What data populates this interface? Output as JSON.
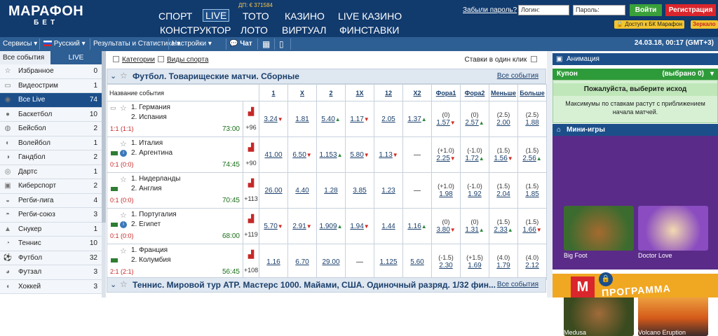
{
  "brand": {
    "line1": "МАРАФОН",
    "line2": "БЕТ",
    "dp": "ДП: € 371584"
  },
  "nav": {
    "row1": [
      "СПОРТ",
      "LIVE",
      "ТОТО",
      "КАЗИНО",
      "LIVE КАЗИНО"
    ],
    "row2": [
      "КОНСТРУКТОР",
      "ЛОТО",
      "ВИРТУАЛ",
      "ФИНСТАВКИ"
    ]
  },
  "auth": {
    "forgot": "Забыли пароль?",
    "login_placeholder": "Логин:",
    "password_placeholder": "Пароль:",
    "login_btn": "Войти",
    "register_btn": "Регистрация",
    "access": "Доступ к БК Марафон",
    "mirror": "Зеркало"
  },
  "toolbar": {
    "services": "Сервисы",
    "language": "Русский",
    "results": "Результаты и Статистика",
    "settings": "Настройки",
    "chat": "Чат",
    "date": "24.03.18, 00:17 (GMT+3)"
  },
  "sidebar": {
    "tabs": [
      "Все события",
      "LIVE"
    ],
    "items": [
      {
        "label": "Избранное",
        "count": "0",
        "icon": "☆"
      },
      {
        "label": "Видеострим",
        "count": "1",
        "icon": "▭"
      },
      {
        "label": "Все Live",
        "count": "74",
        "icon": "◉"
      },
      {
        "label": "Баскетбол",
        "count": "10",
        "icon": "●"
      },
      {
        "label": "Бейсбол",
        "count": "2",
        "icon": "◍"
      },
      {
        "label": "Волейбол",
        "count": "1",
        "icon": "◐"
      },
      {
        "label": "Гандбол",
        "count": "2",
        "icon": "◑"
      },
      {
        "label": "Дартс",
        "count": "1",
        "icon": "◎"
      },
      {
        "label": "Киберспорт",
        "count": "2",
        "icon": "▣"
      },
      {
        "label": "Регби-лига",
        "count": "4",
        "icon": "◒"
      },
      {
        "label": "Регби-союз",
        "count": "3",
        "icon": "◓"
      },
      {
        "label": "Снукер",
        "count": "1",
        "icon": "▲"
      },
      {
        "label": "Теннис",
        "count": "10",
        "icon": "◔"
      },
      {
        "label": "Футбол",
        "count": "32",
        "icon": "⚽"
      },
      {
        "label": "Футзал",
        "count": "3",
        "icon": "◕"
      },
      {
        "label": "Хоккей",
        "count": "3",
        "icon": "◖"
      }
    ]
  },
  "filters": {
    "categories": "Категории",
    "sports_types": "Виды спорта",
    "one_click": "Ставки в один клик"
  },
  "group1": {
    "title": "Футбол. Товарищеские матчи. Сборные",
    "all_events": "Все события"
  },
  "columns": {
    "name": "Название события",
    "c1": "1",
    "cx": "X",
    "c2": "2",
    "c1x": "1X",
    "c12": "12",
    "cx2": "X2",
    "f1": "Фора1",
    "f2": "Фора2",
    "less": "Меньше",
    "more": "Больше"
  },
  "events": [
    {
      "t1": "1. Германия",
      "t2": "2. Испания",
      "score": "1:1 (1:1)",
      "time": "73:00",
      "plus": "+96",
      "o": [
        "3.24",
        "1.81",
        "5.40",
        "1.17",
        "2.05",
        "1.37"
      ],
      "dir": [
        "dn",
        "",
        "up",
        "dn",
        "",
        "up"
      ],
      "h1": "(0)",
      "h1v": "1.57",
      "h1d": "dn",
      "h2": "(0)",
      "h2v": "2.57",
      "h2d": "up",
      "lh": "(2.5)",
      "lv": "2.00",
      "ld": "",
      "mh": "(2.5)",
      "mv": "1.88",
      "md": ""
    },
    {
      "t1": "1. Италия",
      "t2": "2. Аргентина",
      "score": "0:1 (0:0)",
      "time": "74:45",
      "plus": "+90",
      "o": [
        "41.00",
        "6.50",
        "1.153",
        "5.80",
        "1.13",
        "—"
      ],
      "dir": [
        "",
        "dn",
        "up",
        "dn",
        "dn",
        ""
      ],
      "h1": "(+1.0)",
      "h1v": "2.25",
      "h1d": "dn",
      "h2": "(-1.0)",
      "h2v": "1.72",
      "h2d": "up",
      "lh": "(1.5)",
      "lv": "1.56",
      "ld": "dn",
      "mh": "(1.5)",
      "mv": "2.56",
      "md": "up"
    },
    {
      "t1": "1. Нидерланды",
      "t2": "2. Англия",
      "score": "0:1 (0:0)",
      "time": "70:45",
      "plus": "+113",
      "o": [
        "26.00",
        "4.40",
        "1.28",
        "3.85",
        "1.23",
        "—"
      ],
      "dir": [
        "",
        "",
        "",
        "",
        "",
        ""
      ],
      "h1": "(+1.0)",
      "h1v": "1.98",
      "h1d": "",
      "h2": "(-1.0)",
      "h2v": "1.92",
      "h2d": "",
      "lh": "(1.5)",
      "lv": "2.04",
      "ld": "",
      "mh": "(1.5)",
      "mv": "1.85",
      "md": ""
    },
    {
      "t1": "1. Португалия",
      "t2": "2. Египет",
      "score": "0:1 (0:0)",
      "time": "68:00",
      "plus": "+119",
      "o": [
        "5.70",
        "2.91",
        "1.909",
        "1.94",
        "1.44",
        "1.16"
      ],
      "dir": [
        "dn",
        "dn",
        "up",
        "dn",
        "",
        "up"
      ],
      "h1": "(0)",
      "h1v": "3.80",
      "h1d": "dn",
      "h2": "(0)",
      "h2v": "1.31",
      "h2d": "up",
      "lh": "(1.5)",
      "lv": "2.33",
      "ld": "up",
      "mh": "(1.5)",
      "mv": "1.66",
      "md": "dn"
    },
    {
      "t1": "1. Франция",
      "t2": "2. Колумбия",
      "score": "2:1 (2:1)",
      "time": "56:45",
      "plus": "+108",
      "o": [
        "1.16",
        "6.70",
        "29.00",
        "—",
        "1.125",
        "5.60"
      ],
      "dir": [
        "",
        "",
        "",
        "",
        "",
        ""
      ],
      "h1": "(-1.5)",
      "h1v": "2.30",
      "h1d": "",
      "h2": "(+1.5)",
      "h2v": "1.69",
      "h2d": "",
      "lh": "(4.0)",
      "lv": "1.79",
      "ld": "",
      "mh": "(4.0)",
      "mv": "2.12",
      "md": ""
    }
  ],
  "group2": {
    "title": "Теннис. Мировой тур ATP. Мастерс 1000. Майами, США. Одиночный разряд. 1/32 фин...",
    "all_events": "Все события"
  },
  "right": {
    "animation": "Анимация",
    "coupon": "Купон",
    "coupon_selected": "(выбрано 0)",
    "choose": "Пожалуйста, выберите исход",
    "note": "Максимумы по ставкам растут с приближением начала матчей.",
    "mini_games": "Мини-игры",
    "games": [
      "Big Foot",
      "Doctor Love",
      "Medusa",
      "Volcano Eruption"
    ],
    "promo": "ПРОГРАММА"
  }
}
